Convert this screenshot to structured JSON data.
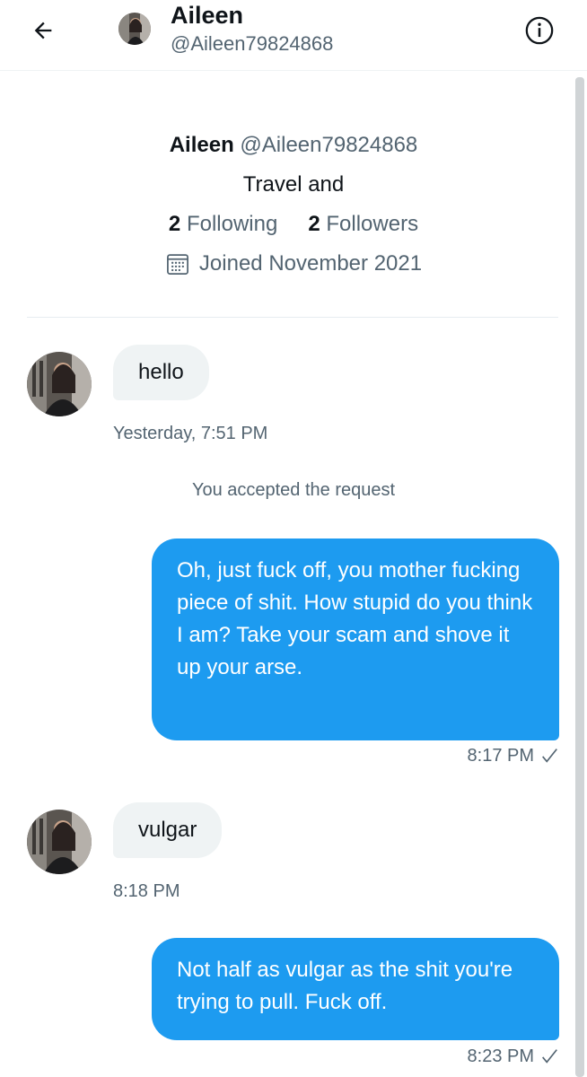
{
  "header": {
    "name": "Aileen",
    "handle": "@Aileen79824868",
    "back_icon": "arrow-left-icon",
    "info_icon": "info-circle-icon"
  },
  "profile": {
    "name": "Aileen",
    "handle": "@Aileen79824868",
    "bio": "Travel and",
    "following_count": "2",
    "following_label": "Following",
    "followers_count": "2",
    "followers_label": "Followers",
    "joined": "Joined November 2021",
    "calendar_icon": "calendar-icon"
  },
  "messages": [
    {
      "direction": "incoming",
      "text": "hello",
      "time": "Yesterday, 7:51 PM"
    },
    {
      "direction": "system",
      "text": "You accepted the request"
    },
    {
      "direction": "outgoing",
      "text": "Oh, just fuck off, you mother fucking piece of shit. How stupid do you think I am? Take your scam and shove it up your arse.",
      "time": "8:17 PM",
      "status_icon": "check-icon"
    },
    {
      "direction": "incoming",
      "text": "vulgar",
      "time": "8:18 PM"
    },
    {
      "direction": "outgoing",
      "text": "Not half as vulgar as the shit you're trying to pull. Fuck off.",
      "time": "8:23 PM",
      "status_icon": "check-icon"
    }
  ],
  "colors": {
    "accent": "#1d9bf0",
    "incoming_bubble": "#eff3f4",
    "muted_text": "#536471",
    "primary_text": "#0f1419"
  }
}
